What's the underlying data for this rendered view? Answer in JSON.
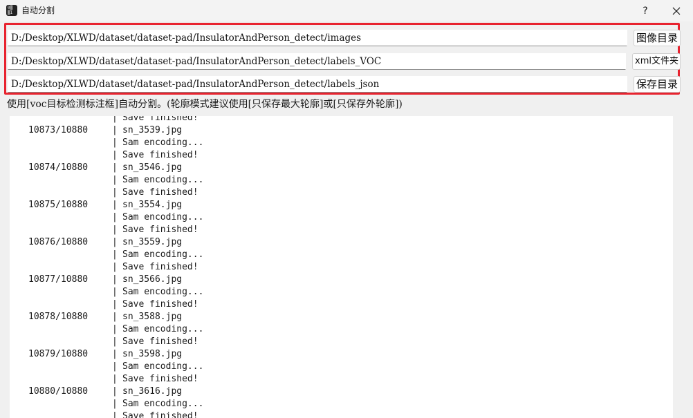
{
  "window": {
    "title": "自动分割",
    "icon_glyph": "0▒\n▒1",
    "help_label": "?",
    "close_icon": "close-icon"
  },
  "paths": {
    "images": {
      "value": "D:/Desktop/XLWD/dataset/dataset-pad/InsulatorAndPerson_detect/images",
      "button": "图像目录"
    },
    "xml": {
      "value": "D:/Desktop/XLWD/dataset/dataset-pad/InsulatorAndPerson_detect/labels_VOC",
      "button": "xml文件夹"
    },
    "save": {
      "value": "D:/Desktop/XLWD/dataset/dataset-pad/InsulatorAndPerson_detect/labels_json",
      "button": "保存目录"
    }
  },
  "hint": "使用[voc目标检测标注框]自动分割。(轮廓模式建议使用[只保存最大轮廓]或[只保存外轮廓])",
  "log": [
    {
      "count": "",
      "msg": "Save finished!"
    },
    {
      "count": "10873/10880",
      "msg": "sn_3539.jpg"
    },
    {
      "count": "",
      "msg": "Sam encoding..."
    },
    {
      "count": "",
      "msg": "Save finished!"
    },
    {
      "count": "10874/10880",
      "msg": "sn_3546.jpg"
    },
    {
      "count": "",
      "msg": "Sam encoding..."
    },
    {
      "count": "",
      "msg": "Save finished!"
    },
    {
      "count": "10875/10880",
      "msg": "sn_3554.jpg"
    },
    {
      "count": "",
      "msg": "Sam encoding..."
    },
    {
      "count": "",
      "msg": "Save finished!"
    },
    {
      "count": "10876/10880",
      "msg": "sn_3559.jpg"
    },
    {
      "count": "",
      "msg": "Sam encoding..."
    },
    {
      "count": "",
      "msg": "Save finished!"
    },
    {
      "count": "10877/10880",
      "msg": "sn_3566.jpg"
    },
    {
      "count": "",
      "msg": "Sam encoding..."
    },
    {
      "count": "",
      "msg": "Save finished!"
    },
    {
      "count": "10878/10880",
      "msg": "sn_3588.jpg"
    },
    {
      "count": "",
      "msg": "Sam encoding..."
    },
    {
      "count": "",
      "msg": "Save finished!"
    },
    {
      "count": "10879/10880",
      "msg": "sn_3598.jpg"
    },
    {
      "count": "",
      "msg": "Sam encoding..."
    },
    {
      "count": "",
      "msg": "Save finished!"
    },
    {
      "count": "10880/10880",
      "msg": "sn_3616.jpg"
    },
    {
      "count": "",
      "msg": "Sam encoding..."
    },
    {
      "count": "",
      "msg": "Save finished!"
    }
  ],
  "log_separator": "|",
  "colors": {
    "highlight_frame": "#e8232f",
    "window_bg": "#f0f0f0",
    "log_bg": "#ffffff"
  }
}
